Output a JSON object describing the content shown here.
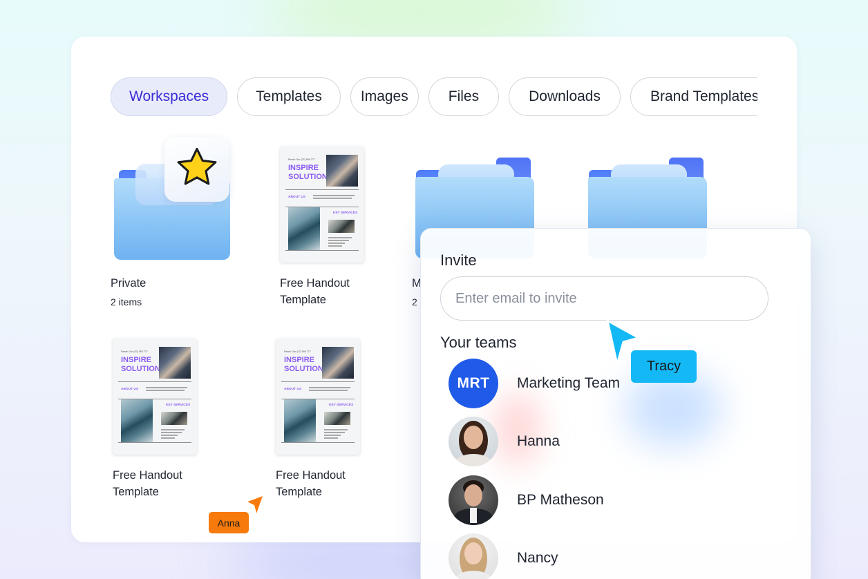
{
  "tabs": [
    {
      "label": "Workspaces",
      "active": true
    },
    {
      "label": "Templates",
      "active": false
    },
    {
      "label": "Images",
      "active": false
    },
    {
      "label": "Files",
      "active": false
    },
    {
      "label": "Downloads",
      "active": false
    },
    {
      "label": "Brand Templates",
      "active": false
    }
  ],
  "items": {
    "private": {
      "name": "Private",
      "meta": "2 items",
      "icon": "star-icon"
    },
    "handout_1": {
      "name": "Free Handout Template"
    },
    "folder_3": {
      "name": "M",
      "meta": "2"
    },
    "handout_2": {
      "name": "Free Handout Template"
    },
    "handout_3": {
      "name": "Free Handout Template"
    }
  },
  "template_doc": {
    "contact": "Reach Our (02) 595 777",
    "title_line_1": "INSPIRE",
    "title_line_2": "SOLUTIONS",
    "about_label": "ABOUT US",
    "services_label": "KEY SERVICES"
  },
  "invite": {
    "title": "Invite",
    "placeholder": "Enter email to invite",
    "teams_title": "Your teams",
    "members": [
      {
        "name": "Marketing Team",
        "initials": "MRT"
      },
      {
        "name": "Hanna"
      },
      {
        "name": "BP Matheson"
      },
      {
        "name": "Nancy"
      }
    ]
  },
  "cursors": {
    "tracy": {
      "name": "Tracy",
      "color": "#14b8f5"
    },
    "anna": {
      "name": "Anna",
      "color": "#f77a0c"
    }
  },
  "colors": {
    "accent": "#3a2bd6",
    "avatar_team": "#1f5ae8",
    "folder": "#8ac4f5"
  }
}
